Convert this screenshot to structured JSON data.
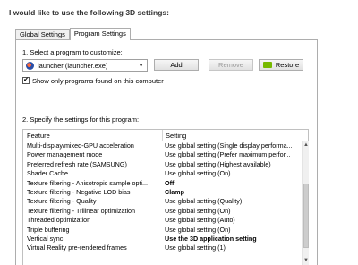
{
  "heading": "I would like to use the following 3D settings:",
  "tabs": [
    {
      "label": "Global Settings",
      "active": false
    },
    {
      "label": "Program Settings",
      "active": true
    }
  ],
  "step1": {
    "label": "1. Select a program to customize:",
    "program": "launcher (launcher.exe)",
    "add_label": "Add",
    "remove_label": "Remove",
    "restore_label": "Restore",
    "show_only_label": "Show only programs found on this computer",
    "show_only_checked": true
  },
  "step2": {
    "label": "2. Specify the settings for this program:",
    "columns": {
      "feature": "Feature",
      "setting": "Setting"
    },
    "rows": [
      {
        "feature": "Multi-display/mixed-GPU acceleration",
        "setting": "Use global setting (Single display performa...",
        "bold": false
      },
      {
        "feature": "Power management mode",
        "setting": "Use global setting (Prefer maximum perfor...",
        "bold": false
      },
      {
        "feature": "Preferred refresh rate (SAMSUNG)",
        "setting": "Use global setting (Highest available)",
        "bold": false
      },
      {
        "feature": "Shader Cache",
        "setting": "Use global setting (On)",
        "bold": false
      },
      {
        "feature": "Texture filtering - Anisotropic sample opti...",
        "setting": "Off",
        "bold": true
      },
      {
        "feature": "Texture filtering - Negative LOD bias",
        "setting": "Clamp",
        "bold": true
      },
      {
        "feature": "Texture filtering - Quality",
        "setting": "Use global setting (Quality)",
        "bold": false
      },
      {
        "feature": "Texture filtering - Trilinear optimization",
        "setting": "Use global setting (On)",
        "bold": false
      },
      {
        "feature": "Threaded optimization",
        "setting": "Use global setting (Auto)",
        "bold": false
      },
      {
        "feature": "Triple buffering",
        "setting": "Use global setting (On)",
        "bold": false
      },
      {
        "feature": "Vertical sync",
        "setting": "Use the 3D application setting",
        "bold": true
      },
      {
        "feature": "Virtual Reality pre-rendered frames",
        "setting": "Use global setting (1)",
        "bold": false
      }
    ]
  },
  "icons": {
    "program": "game-launcher-icon",
    "restore": "nvidia-logo-icon",
    "dropdown": "chevron-down-icon",
    "check": "checkmark-icon",
    "scroll_up": "scroll-up-arrow-icon",
    "scroll_down": "scroll-down-arrow-icon"
  },
  "colors": {
    "nvidia_green": "#76b900",
    "border": "#adadad"
  }
}
